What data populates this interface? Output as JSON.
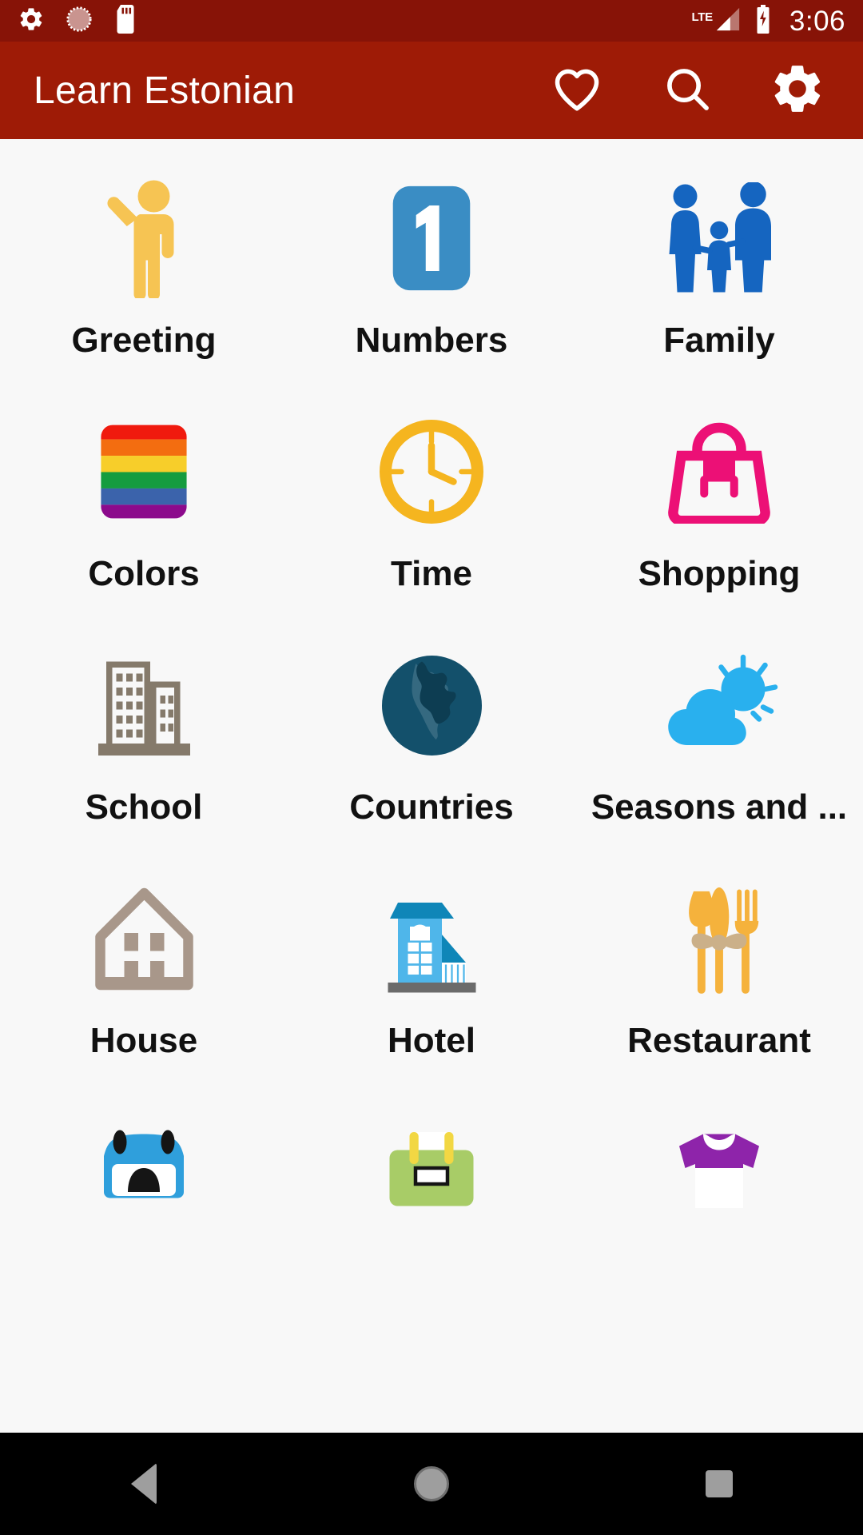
{
  "status_bar": {
    "background_color": "#871307",
    "left_icons": [
      {
        "name": "gear-icon",
        "label": "settings"
      },
      {
        "name": "screen-rotation-icon",
        "label": "rotation"
      },
      {
        "name": "sd-card-icon",
        "label": "sd-card"
      }
    ],
    "network_label": "LTE",
    "signal_bars": 2,
    "battery": {
      "name": "battery-charging-icon",
      "charging": true
    },
    "clock": "3:06"
  },
  "app_bar": {
    "background_color": "#9e1b06",
    "title": "Learn Estonian",
    "actions": [
      {
        "name": "favorite-heart-icon",
        "label": "Favorites"
      },
      {
        "name": "search-icon",
        "label": "Search"
      },
      {
        "name": "settings-gear-icon",
        "label": "Settings"
      }
    ]
  },
  "grid": {
    "background_color": "#f8f8f8",
    "columns": 3,
    "items": [
      {
        "label": "Greeting",
        "icon": "waving-person-icon",
        "color": "#f6c453"
      },
      {
        "label": "Numbers",
        "icon": "number-one-icon",
        "color": "#3a8dc4"
      },
      {
        "label": "Family",
        "icon": "family-icon",
        "color": "#1565c0"
      },
      {
        "label": "Colors",
        "icon": "rainbow-palette-icon",
        "color": "#e8302a"
      },
      {
        "label": "Time",
        "icon": "clock-icon",
        "color": "#f5b51f"
      },
      {
        "label": "Shopping",
        "icon": "handbag-icon",
        "color": "#ec1076"
      },
      {
        "label": "School",
        "icon": "buildings-icon",
        "color": "#857a6b"
      },
      {
        "label": "Countries",
        "icon": "globe-icon",
        "color": "#13506b"
      },
      {
        "label": "Seasons and ...",
        "icon": "sun-cloud-icon",
        "color": "#29b0ee"
      },
      {
        "label": "House",
        "icon": "house-icon",
        "color": "#a8978a"
      },
      {
        "label": "Hotel",
        "icon": "hotel-icon",
        "color": "#4fb6ea"
      },
      {
        "label": "Restaurant",
        "icon": "cutlery-icon",
        "color": "#f5b23c"
      },
      {
        "label": "",
        "icon": "car-icon",
        "color": "#2f9fdc"
      },
      {
        "label": "",
        "icon": "toolbox-icon",
        "color": "#a8cc67"
      },
      {
        "label": "",
        "icon": "shirt-icon",
        "color": "#8e24aa"
      }
    ]
  },
  "nav_bar": {
    "background_color": "#000000",
    "buttons": [
      {
        "name": "nav-back-button",
        "label": "Back"
      },
      {
        "name": "nav-home-button",
        "label": "Home"
      },
      {
        "name": "nav-recents-button",
        "label": "Recents"
      }
    ]
  }
}
